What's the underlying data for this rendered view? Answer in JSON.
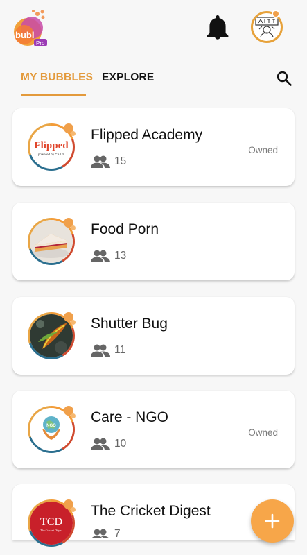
{
  "app": {
    "logo_text": "bubl",
    "logo_badge": "Pro"
  },
  "tabs": [
    {
      "label": "MY BUBBLES",
      "active": true
    },
    {
      "label": "EXPLORE",
      "active": false
    }
  ],
  "bubbles": [
    {
      "name": "Flipped Academy",
      "members": "15",
      "owned": "Owned",
      "avatar_text": "Flipped",
      "avatar_subtext": "powered by CAIUS"
    },
    {
      "name": "Food Porn",
      "members": "13",
      "owned": ""
    },
    {
      "name": "Shutter Bug",
      "members": "11",
      "owned": ""
    },
    {
      "name": "Care - NGO",
      "members": "10",
      "owned": "Owned",
      "avatar_text": "NGO"
    },
    {
      "name": "The Cricket Digest",
      "members": "7",
      "owned": "",
      "avatar_text": "TCD",
      "avatar_subtext": "The Cricket Digest"
    }
  ],
  "colors": {
    "accent": "#e39a3c",
    "fab": "#f7a649"
  },
  "icons": {
    "notifications": "bell-icon",
    "search": "search-icon",
    "members": "people-icon",
    "add": "plus-icon"
  }
}
